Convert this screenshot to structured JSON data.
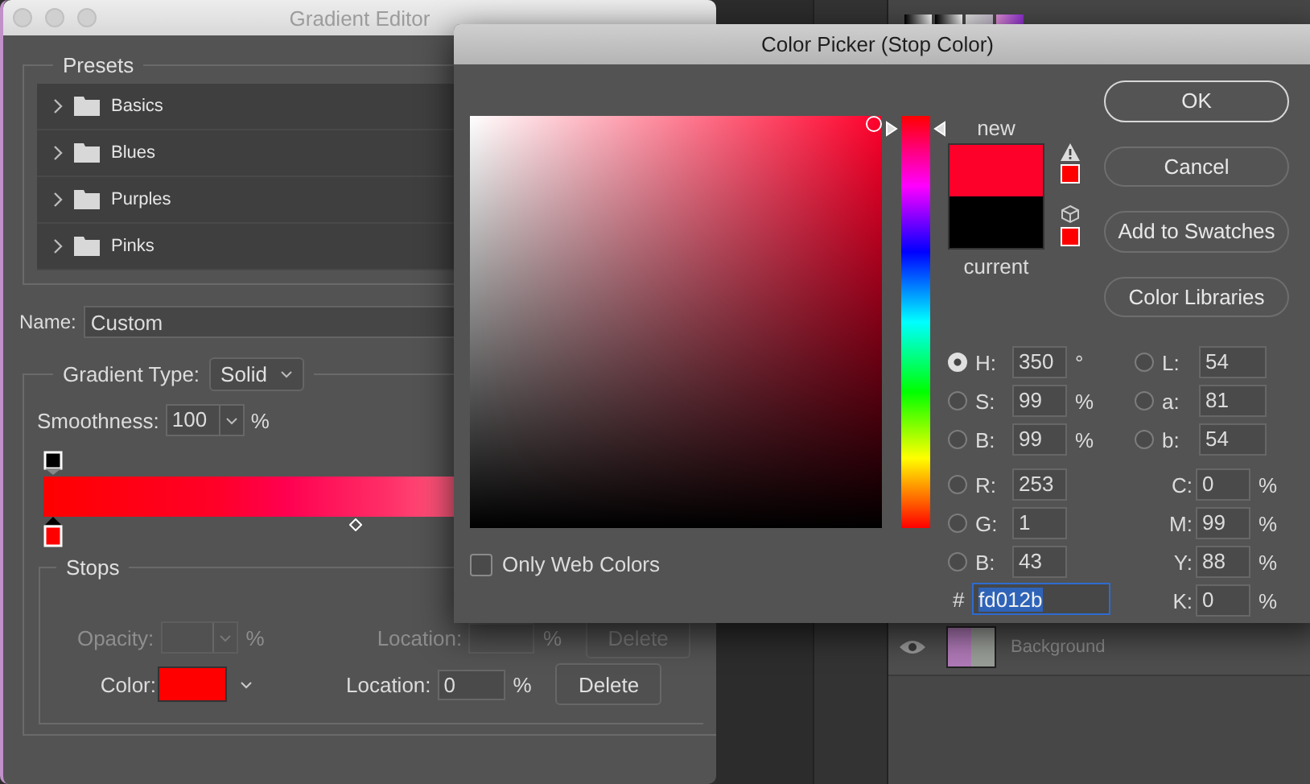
{
  "background_app": {
    "layer": {
      "name": "Background",
      "visible": true
    }
  },
  "gradient_editor": {
    "title": "Gradient Editor",
    "presets": {
      "label": "Presets",
      "items": [
        {
          "label": "Basics",
          "expanded": false
        },
        {
          "label": "Blues",
          "expanded": false
        },
        {
          "label": "Purples",
          "expanded": false
        },
        {
          "label": "Pinks",
          "expanded": false
        }
      ]
    },
    "name": {
      "label": "Name:",
      "value": "Custom"
    },
    "gradient_type": {
      "label": "Gradient Type:",
      "value": "Solid"
    },
    "smoothness": {
      "label": "Smoothness:",
      "value": "100",
      "unit": "%"
    },
    "stops": {
      "label": "Stops",
      "rows": [
        {
          "kind": "opacity",
          "label": "Opacity:",
          "unit": "%",
          "location_label": "Location:",
          "location_value": "",
          "location_unit": "%",
          "delete_label": "Delete",
          "disabled": true
        },
        {
          "kind": "color",
          "label": "Color:",
          "location_label": "Location:",
          "location_value": "0",
          "location_unit": "%",
          "delete_label": "Delete",
          "disabled": false
        }
      ]
    }
  },
  "color_picker": {
    "title": "Color Picker (Stop Color)",
    "hue_slider": {
      "level": 0.97
    },
    "new_label": "new",
    "current_label": "current",
    "buttons": [
      {
        "label": "OK",
        "default": true
      },
      {
        "label": "Cancel",
        "default": false
      },
      {
        "label": "Add to Swatches",
        "default": false
      },
      {
        "label": "Color Libraries",
        "default": false
      }
    ],
    "only_web_colors": {
      "label": "Only Web Colors",
      "checked": false
    },
    "hsb_rgb": [
      {
        "label": "H:",
        "value": "350",
        "unit": "°",
        "selected": true
      },
      {
        "label": "S:",
        "value": "99",
        "unit": "%",
        "selected": false
      },
      {
        "label": "B:",
        "value": "99",
        "unit": "%",
        "selected": false
      },
      {
        "label": "R:",
        "value": "253",
        "selected": false
      },
      {
        "label": "G:",
        "value": "1",
        "selected": false
      },
      {
        "label": "B:",
        "value": "43",
        "selected": false
      }
    ],
    "lab": [
      {
        "label": "L:",
        "value": "54",
        "selected": false
      },
      {
        "label": "a:",
        "value": "81",
        "selected": false
      },
      {
        "label": "b:",
        "value": "54",
        "selected": false
      }
    ],
    "cmyk": [
      {
        "label": "C:",
        "value": "0",
        "unit": "%"
      },
      {
        "label": "M:",
        "value": "99",
        "unit": "%"
      },
      {
        "label": "Y:",
        "value": "88",
        "unit": "%"
      },
      {
        "label": "K:",
        "value": "0",
        "unit": "%"
      }
    ],
    "hex": {
      "label": "#",
      "value": "fd012b"
    }
  }
}
